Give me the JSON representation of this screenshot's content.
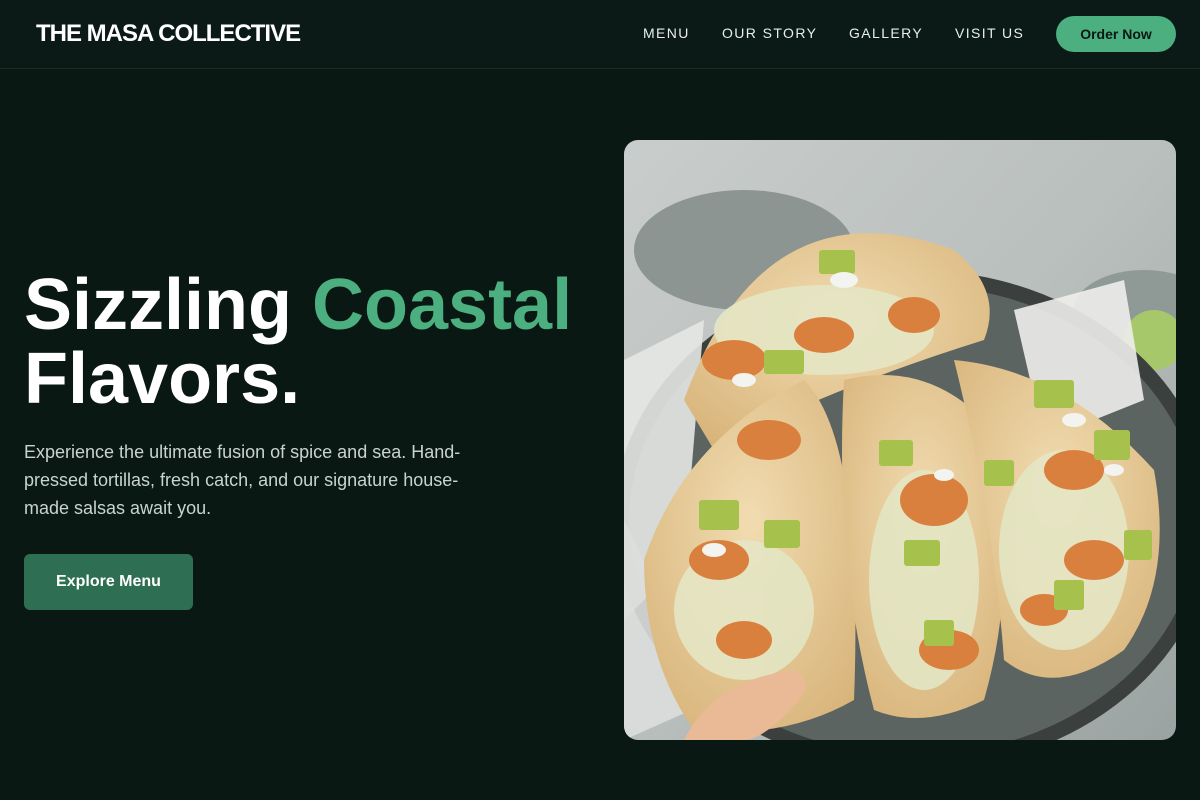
{
  "header": {
    "brand": "THE MASA COLLECTIVE",
    "nav": [
      {
        "label": "MENU"
      },
      {
        "label": "OUR STORY"
      },
      {
        "label": "GALLERY"
      },
      {
        "label": "VISIT US"
      }
    ],
    "cta_label": "Order Now"
  },
  "hero": {
    "title_part1": "Sizzling",
    "title_accent": "Coastal",
    "title_part2": "Flavors.",
    "description": "Experience the ultimate fusion of spice and sea. Hand-pressed tortillas, fresh catch, and our signature house-made salsas await you.",
    "button_label": "Explore Menu",
    "image_subject": "shrimp-tacos-photo"
  },
  "colors": {
    "background": "#0a1814",
    "accent": "#4caf80",
    "button": "#2e6e52"
  }
}
